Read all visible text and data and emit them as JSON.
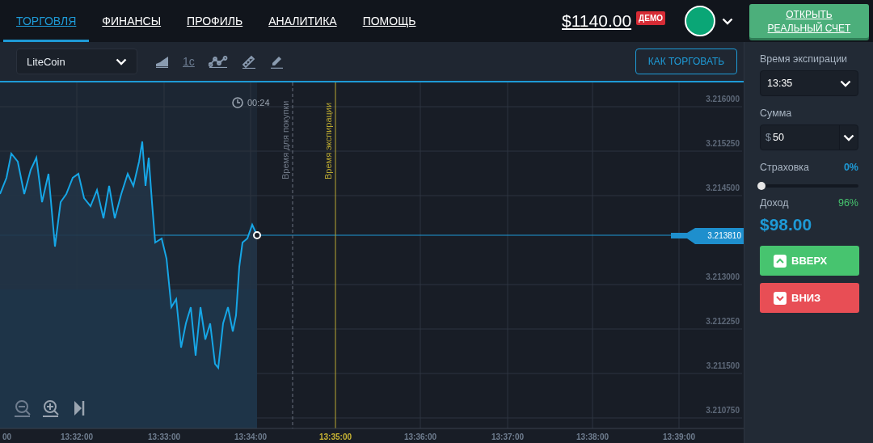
{
  "nav": {
    "tabs": [
      {
        "label": "ТОРГОВЛЯ",
        "selected": true
      },
      {
        "label": "ФИНАНСЫ",
        "selected": false
      },
      {
        "label": "ПРОФИЛЬ",
        "selected": false
      },
      {
        "label": "АНАЛИТИКА",
        "selected": false
      },
      {
        "label": "ПОМОЩЬ",
        "selected": false
      }
    ],
    "balance": "$1140.00",
    "account_badge": "ДЕМО",
    "open_account_lines": [
      "ОТКРЫТЬ",
      "РЕАЛЬНЫЙ СЧЕТ"
    ]
  },
  "toolbar": {
    "asset": "LiteCoin",
    "timeframe": "1с",
    "how_to_trade": "КАК ТОРГОВАТЬ"
  },
  "chart": {
    "timer": "00:24",
    "purchase_line_label": "Время для покупки",
    "expiry_line_label": "Время экспирации",
    "current_price": "3.213810",
    "y_labels": [
      "3.216000",
      "3.215250",
      "3.214500",
      "3.213000",
      "3.212250",
      "3.211500",
      "3.210750"
    ],
    "x_labels": [
      {
        "label": "00",
        "kind": "normal"
      },
      {
        "label": "13:32:00",
        "kind": "normal"
      },
      {
        "label": "13:33:00",
        "kind": "normal"
      },
      {
        "label": "13:34:00",
        "kind": "normal"
      },
      {
        "label": "13:35:00",
        "kind": "expiry"
      },
      {
        "label": "13:36:00",
        "kind": "normal"
      },
      {
        "label": "13:37:00",
        "kind": "normal"
      },
      {
        "label": "13:38:00",
        "kind": "normal"
      },
      {
        "label": "13:39:00",
        "kind": "normal"
      }
    ]
  },
  "panel": {
    "expiry_label": "Время экспирации",
    "expiry_value": "13:35",
    "amount_label": "Сумма",
    "amount_currency": "$",
    "amount_value": "50",
    "insurance_label": "Страховка",
    "insurance_value": "0%",
    "insurance": {
      "level": 0
    },
    "income_label": "Доход",
    "income_percent": "96%",
    "income_value": "$98.00",
    "buttons": [
      {
        "label": "ВВЕРХ",
        "kind": "up"
      },
      {
        "label": "ВНИЗ",
        "kind": "down"
      }
    ]
  }
}
